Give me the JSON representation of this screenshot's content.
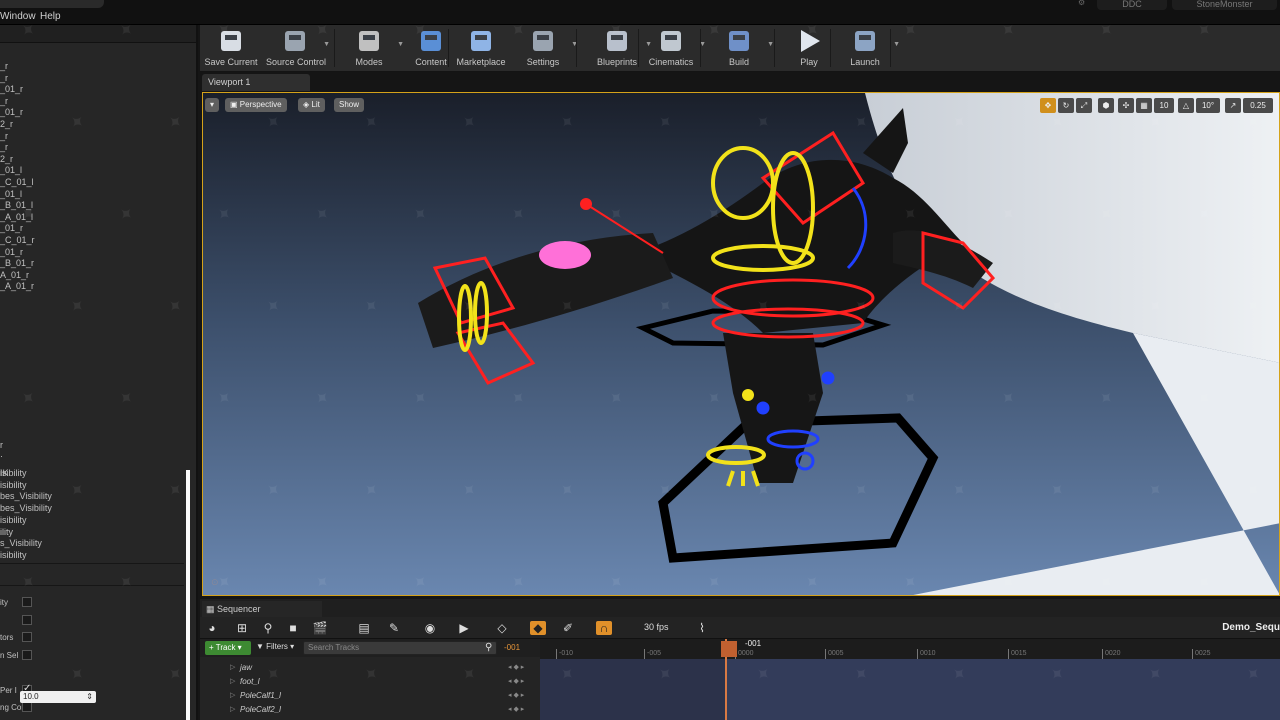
{
  "menu": {
    "window": "Window",
    "help": "Help",
    "project_left": "DDC",
    "project_right": "StoneMonster"
  },
  "left_panel": {
    "bones": [
      "_r",
      "_r",
      "_01_r",
      "_r",
      "_01_r",
      "2_r",
      "_r",
      "_r",
      "2_r",
      "_01_l",
      "_C_01_l",
      "_01_l",
      "_B_01_l",
      "_A_01_l",
      "_01_r",
      "_C_01_r",
      "_01_r",
      "_B_01_r",
      "A_01_r",
      "_A_01_r"
    ],
    "ik_label": "IK",
    "visibility_items": [
      "isibility",
      "isibility",
      "bes_Visibility",
      "bes_Visibility",
      "isibility",
      "ility",
      "s_Visibility",
      "isibility"
    ],
    "props": [
      "ity",
      "",
      "tors",
      "n Sel",
      "",
      "Per I",
      "ng Cor"
    ],
    "number_value": "10.0"
  },
  "toolbar": [
    {
      "label": "Save Current",
      "icon": "save-icon"
    },
    {
      "label": "Source Control",
      "icon": "source-control-icon"
    },
    {
      "label": "Modes",
      "icon": "modes-icon"
    },
    {
      "label": "Content",
      "icon": "content-icon"
    },
    {
      "label": "Marketplace",
      "icon": "marketplace-icon"
    },
    {
      "label": "Settings",
      "icon": "settings-icon"
    },
    {
      "label": "Blueprints",
      "icon": "blueprints-icon"
    },
    {
      "label": "Cinematics",
      "icon": "cinematics-icon"
    },
    {
      "label": "Build",
      "icon": "build-icon"
    },
    {
      "label": "Play",
      "icon": "play-icon"
    },
    {
      "label": "Launch",
      "icon": "launch-icon"
    }
  ],
  "viewport": {
    "tab": "Viewport 1",
    "perspective": "Perspective",
    "lit": "Lit",
    "show": "Show",
    "grid_snap": "10",
    "rot_snap": "10°",
    "scale_snap": "0.25"
  },
  "sequencer": {
    "tab": "Sequencer",
    "fps": "30 fps",
    "sequence_name": "Demo_Sequ",
    "track_button": "Track",
    "filters": "Filters",
    "search_placeholder": "Search Tracks",
    "current_frame": "-001",
    "playhead_label": "-001",
    "ticks": [
      "-010",
      "-005",
      "0000",
      "0005",
      "0010",
      "0015",
      "0020",
      "0025"
    ],
    "tracks": [
      "jaw",
      "foot_l",
      "PoleCalf1_l",
      "PoleCalf2_l"
    ]
  },
  "colors": {
    "accent": "#d4a21a",
    "track_green": "#3d8a32",
    "playhead": "#d97a44",
    "rig_red": "#ff2020",
    "rig_yellow": "#f2e21a",
    "rig_blue": "#2040ff",
    "rig_pink": "#ff60d0"
  }
}
